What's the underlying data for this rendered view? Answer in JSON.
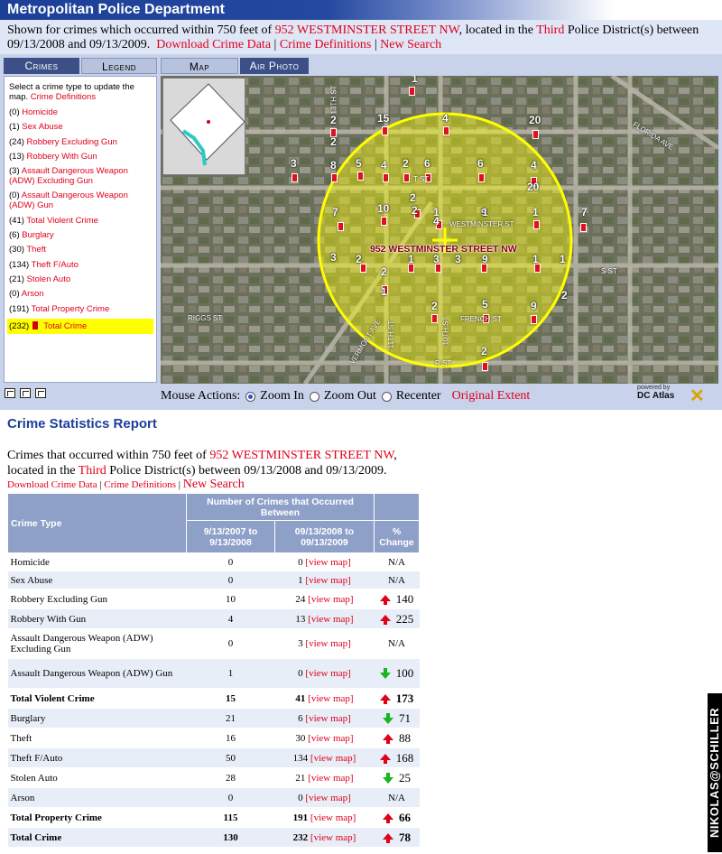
{
  "header": {
    "title": "Metropolitan Police Department",
    "info_prefix": "Shown for crimes which occurred within 750 feet of ",
    "address": "952 WESTMINSTER STREET NW",
    "info_mid": ", located in the ",
    "district": "Third",
    "info_suffix": " Police District(s) between",
    "dates": "09/13/2008 and 09/13/2009.",
    "link_download": "Download Crime Data",
    "link_definitions": "Crime Definitions",
    "link_new_search": "New Search",
    "separator": "|"
  },
  "tabs": {
    "crimes": "Crimes",
    "legend": "Legend",
    "map": "Map",
    "air_photo": "Air Photo"
  },
  "left_panel": {
    "intro": "Select a crime type to update the map.",
    "intro_link": "Crime Definitions",
    "items": [
      {
        "count": "(0)",
        "name": "Homicide"
      },
      {
        "count": "(1)",
        "name": "Sex Abuse"
      },
      {
        "count": "(24)",
        "name": "Robbery Excluding Gun"
      },
      {
        "count": "(13)",
        "name": "Robbery With Gun"
      },
      {
        "count": "(3)",
        "name": "Assault Dangerous Weapon (ADW) Excluding Gun"
      },
      {
        "count": "(0)",
        "name": "Assault Dangerous Weapon (ADW) Gun"
      },
      {
        "count": "(41)",
        "name": "Total Violent Crime"
      },
      {
        "count": "(6)",
        "name": "Burglary"
      },
      {
        "count": "(30)",
        "name": "Theft"
      },
      {
        "count": "(134)",
        "name": "Theft F/Auto"
      },
      {
        "count": "(21)",
        "name": "Stolen Auto"
      },
      {
        "count": "(0)",
        "name": "Arson"
      },
      {
        "count": "(191)",
        "name": "Total Property Crime"
      },
      {
        "count": "(232)",
        "name": "Total Crime"
      }
    ]
  },
  "map": {
    "address_label": "952 WESTMINSTER STREET NW",
    "streets": {
      "westminster": "WESTMINSTER ST",
      "french": "FRENCH ST",
      "r": "R ST",
      "riggs": "RIGGS ST",
      "s": "S ST",
      "t": "T ST",
      "tenth": "10TH ST",
      "eleventh": "11TH ST",
      "florida": "FLORIDA AVE",
      "vermont": "VERMONT AVE",
      "thirteenth": "13TH ST"
    },
    "numbers": [
      "1",
      "2",
      "15",
      "4",
      "20",
      "2",
      "3",
      "8",
      "5",
      "4",
      "2",
      "6",
      "6",
      "4",
      "2",
      "20",
      "10",
      "7",
      "2",
      "1",
      "9",
      "4",
      "7",
      "1",
      "3",
      "2",
      "2",
      "1",
      "3",
      "3",
      "9",
      "1",
      "1",
      "1",
      "2",
      "5",
      "9",
      "2",
      "1",
      "2"
    ]
  },
  "mouse_actions": {
    "label": "Mouse Actions:",
    "zoom_in": "Zoom In",
    "zoom_out": "Zoom Out",
    "recenter": "Recenter",
    "original_extent": "Original Extent",
    "selected": "Zoom In"
  },
  "powered_by": {
    "line1": "powered by",
    "line2": "DC Atlas"
  },
  "report": {
    "title": "Crime Statistics Report",
    "text_prefix": "Crimes that occurred within 750 feet of ",
    "address": "952 WESTMINSTER STREET NW",
    "text_mid1": ",",
    "text_mid2": "located in the ",
    "district": "Third",
    "text_suffix": " Police District(s) between 09/13/2008 and 09/13/2009.",
    "link_download": "Download Crime Data",
    "link_definitions": "Crime Definitions",
    "link_new_search": "New Search",
    "separator": "|"
  },
  "table": {
    "group_header": "Number of Crimes that Occurred Between",
    "col_type": "Crime Type",
    "col_prev": "9/13/2007 to 9/13/2008",
    "col_curr": "09/13/2008 to 09/13/2009",
    "col_change": "% Change",
    "view_map": "[view map]",
    "rows": [
      {
        "type": "Homicide",
        "prev": "0",
        "curr": "0",
        "change": "N/A",
        "dir": "none",
        "bold": false
      },
      {
        "type": "Sex Abuse",
        "prev": "0",
        "curr": "1",
        "change": "N/A",
        "dir": "none",
        "bold": false
      },
      {
        "type": "Robbery Excluding Gun",
        "prev": "10",
        "curr": "24",
        "change": "140",
        "dir": "up",
        "bold": false
      },
      {
        "type": "Robbery With Gun",
        "prev": "4",
        "curr": "13",
        "change": "225",
        "dir": "up",
        "bold": false
      },
      {
        "type": "Assault Dangerous Weapon (ADW) Excluding Gun",
        "prev": "0",
        "curr": "3",
        "change": "N/A",
        "dir": "none",
        "bold": false
      },
      {
        "type": "Assault Dangerous Weapon (ADW) Gun",
        "prev": "1",
        "curr": "0",
        "change": "100",
        "dir": "down",
        "bold": false
      },
      {
        "type": "Total Violent Crime",
        "prev": "15",
        "curr": "41",
        "change": "173",
        "dir": "up",
        "bold": true
      },
      {
        "type": "Burglary",
        "prev": "21",
        "curr": "6",
        "change": "71",
        "dir": "down",
        "bold": false
      },
      {
        "type": "Theft",
        "prev": "16",
        "curr": "30",
        "change": "88",
        "dir": "up",
        "bold": false
      },
      {
        "type": "Theft F/Auto",
        "prev": "50",
        "curr": "134",
        "change": "168",
        "dir": "up",
        "bold": false
      },
      {
        "type": "Stolen Auto",
        "prev": "28",
        "curr": "21",
        "change": "25",
        "dir": "down",
        "bold": false
      },
      {
        "type": "Arson",
        "prev": "0",
        "curr": "0",
        "change": "N/A",
        "dir": "none",
        "bold": false
      },
      {
        "type": "Total Property Crime",
        "prev": "115",
        "curr": "191",
        "change": "66",
        "dir": "up",
        "bold": true
      },
      {
        "type": "Total Crime",
        "prev": "130",
        "curr": "232",
        "change": "78",
        "dir": "up",
        "bold": true
      }
    ]
  },
  "watermark": "NIKOLAS@SCHILLER",
  "colors": {
    "brand_blue": "#1c3f98",
    "link_red": "#e0001b",
    "buffer_yellow": "#ffff00",
    "up_arrow": "#e0001b",
    "down_arrow": "#18b51c"
  }
}
